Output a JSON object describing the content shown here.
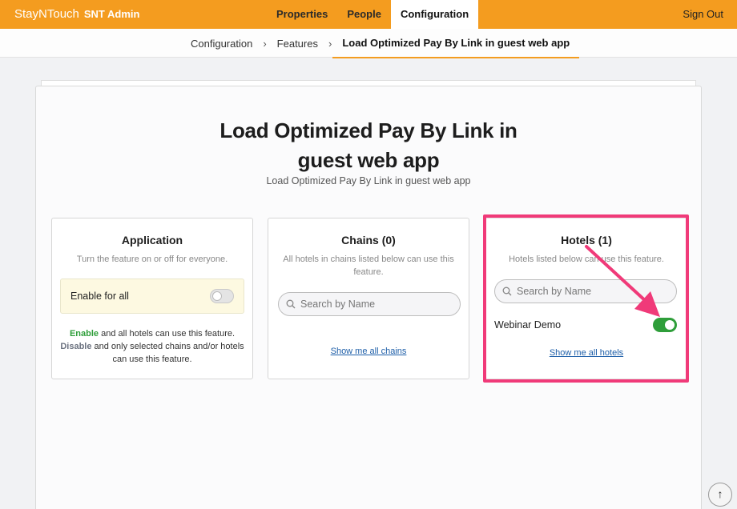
{
  "header": {
    "brand": "StayNTouch",
    "brand_suffix": "SNT Admin",
    "nav": [
      "Properties",
      "People",
      "Configuration"
    ],
    "active_nav": "Configuration",
    "signout": "Sign Out"
  },
  "breadcrumb": {
    "items": [
      "Configuration",
      "Features"
    ],
    "separator": "›",
    "current": "Load Optimized Pay By Link in guest web app"
  },
  "page": {
    "title_line1": "Load Optimized Pay By Link in",
    "title_line2": "guest web app",
    "subtitle": "Load Optimized Pay By Link in guest web app"
  },
  "application": {
    "title": "Application",
    "desc": "Turn the feature on or off for everyone.",
    "enable_label": "Enable for all",
    "enable_on": false,
    "note_enable": "Enable",
    "note_enable_rest": " and all hotels can use this feature.",
    "note_disable": "Disable",
    "note_disable_rest": " and only selected chains and/or hotels can use this feature."
  },
  "chains": {
    "title": "Chains (0)",
    "desc": "All hotels in chains listed below can use this feature.",
    "search_placeholder": "Search by Name",
    "show_all": "Show me all chains"
  },
  "hotels": {
    "title": "Hotels (1)",
    "desc": "Hotels listed below can use this feature.",
    "search_placeholder": "Search by Name",
    "items": [
      {
        "name": "Webinar Demo",
        "enabled": true
      }
    ],
    "show_all": "Show me all hotels"
  },
  "colors": {
    "accent": "#f49c1f",
    "success": "#2f9e3a",
    "highlight": "#f03a79",
    "link": "#1d5ea8"
  },
  "icons": [
    "search-icon",
    "arrow-up-icon",
    "annotation-arrow"
  ]
}
